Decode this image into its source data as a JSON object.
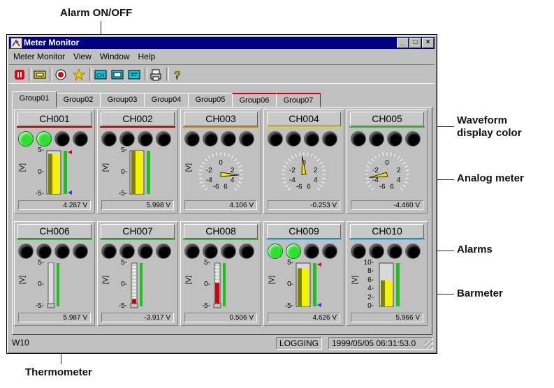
{
  "callouts": {
    "alarm_onoff": "Alarm ON/OFF",
    "waveform_color": "Waveform\ndisplay color",
    "analog_meter": "Analog meter",
    "alarms": "Alarms",
    "barmeter": "Barmeter",
    "thermometer": "Thermometer"
  },
  "window": {
    "title": "Meter Monitor",
    "title_buttons": [
      "_",
      "□",
      "×"
    ]
  },
  "menu": [
    "Meter Monitor",
    "View",
    "Window",
    "Help"
  ],
  "toolbar": [
    "pause-icon",
    "meter-icon",
    "alarm-onoff-icon",
    "flash-icon",
    "ch-icon",
    "tag-icon",
    "comment-icon",
    "print-icon",
    "help-icon"
  ],
  "tabs": [
    {
      "label": "Group01",
      "active": true,
      "alarm": false
    },
    {
      "label": "Group02",
      "active": false,
      "alarm": false
    },
    {
      "label": "Group03",
      "active": false,
      "alarm": false
    },
    {
      "label": "Group04",
      "active": false,
      "alarm": false
    },
    {
      "label": "Group05",
      "active": false,
      "alarm": false
    },
    {
      "label": "Group06",
      "active": false,
      "alarm": true
    },
    {
      "label": "Group07",
      "active": false,
      "alarm": true
    }
  ],
  "channels": [
    {
      "name": "CH001",
      "type": "bar",
      "color": "#cc0000",
      "lamps": [
        true,
        true,
        false,
        false
      ],
      "value": "4.287 V",
      "unit": "[V]",
      "ticks": [
        "5-",
        "0-",
        "-5-"
      ],
      "level": 0.93
    },
    {
      "name": "CH002",
      "type": "bar",
      "color": "#cc0000",
      "lamps": [
        false,
        false,
        false,
        false
      ],
      "value": "5.998 V",
      "unit": "[V]",
      "ticks": [
        "5-",
        "0-",
        "-5-"
      ],
      "level": 1.0
    },
    {
      "name": "CH003",
      "type": "analog",
      "color": "#e08000",
      "lamps": [
        false,
        false,
        false,
        false
      ],
      "value": "4.106 V",
      "unit": "[V]",
      "ticks": [
        "-2",
        "0",
        "2",
        "-4",
        "4",
        "-6",
        "6"
      ],
      "level": 0.84
    },
    {
      "name": "CH004",
      "type": "analog",
      "color": "#e0e000",
      "lamps": [
        false,
        false,
        false,
        false
      ],
      "value": "-0.253 V",
      "unit": "",
      "ticks": [
        "-2",
        "0",
        "2",
        "-4",
        "4",
        "-6",
        "6"
      ],
      "level": 0.48
    },
    {
      "name": "CH005",
      "type": "analog",
      "color": "#30c030",
      "lamps": [
        false,
        false,
        false,
        false
      ],
      "value": "-4.460 V",
      "unit": "",
      "ticks": [
        "-2",
        "0",
        "2",
        "-4",
        "4",
        "-6",
        "6"
      ],
      "level": 0.13
    },
    {
      "name": "CH006",
      "type": "thermo",
      "color": "#30c030",
      "lamps": [
        false,
        false,
        false,
        false
      ],
      "value": "5.987 V",
      "unit": "[V]",
      "ticks": [
        "5-",
        "0-",
        "-5-"
      ],
      "level": 1.0
    },
    {
      "name": "CH007",
      "type": "thermo",
      "color": "#30c030",
      "lamps": [
        false,
        false,
        false,
        false
      ],
      "value": "-3.917 V",
      "unit": "[V]",
      "ticks": [
        "5-",
        "0-",
        "-5-"
      ],
      "level": 0.17
    },
    {
      "name": "CH008",
      "type": "thermo",
      "color": "#30c030",
      "lamps": [
        false,
        false,
        false,
        false
      ],
      "value": "0.506 V",
      "unit": "[V]",
      "ticks": [
        "5-",
        "0-",
        "-5-"
      ],
      "level": 0.54
    },
    {
      "name": "CH009",
      "type": "bar",
      "color": "#30c0ff",
      "lamps": [
        true,
        true,
        false,
        false
      ],
      "value": "4.626 V",
      "unit": "[V]",
      "ticks": [
        "5-",
        "0-",
        "-5-"
      ],
      "level": 0.88
    },
    {
      "name": "CH010",
      "type": "bar10",
      "color": "#30c0ff",
      "lamps": [
        false,
        false,
        false,
        false
      ],
      "value": "5.966 V",
      "unit": "[V]",
      "ticks": [
        "10-",
        "8-",
        "6-",
        "4-",
        "2-",
        "0-"
      ],
      "level": 0.6
    }
  ],
  "status": {
    "left": "W10",
    "logging": "LOGGING",
    "datetime": "1999/05/05 06:31:53.0"
  }
}
